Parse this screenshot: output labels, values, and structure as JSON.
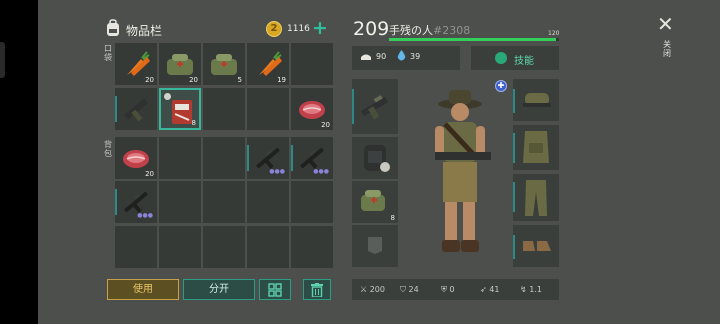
{
  "inventory": {
    "title": "物品栏",
    "coins": "1116",
    "pocket_label": "口袋",
    "backpack_label": "背包"
  },
  "slots": [
    {
      "icon": "carrot-icon",
      "count": "20"
    },
    {
      "icon": "medkit-bag-icon",
      "count": "20"
    },
    {
      "icon": "medkit-bag-icon",
      "count": "5"
    },
    {
      "icon": "carrot-icon",
      "count": "19"
    },
    {
      "icon": "",
      "count": ""
    },
    {
      "icon": "assault-rifle-icon",
      "count": ""
    },
    {
      "icon": "bandage-pack-icon",
      "count": "8"
    },
    {
      "icon": "",
      "count": ""
    },
    {
      "icon": "",
      "count": ""
    },
    {
      "icon": "raw-steak-icon",
      "count": "20"
    },
    {
      "icon": "raw-steak-icon",
      "count": "20"
    },
    {
      "icon": "",
      "count": ""
    },
    {
      "icon": "",
      "count": ""
    },
    {
      "icon": "black-rifle-icon",
      "count": ""
    },
    {
      "icon": "black-rifle-icon",
      "count": ""
    },
    {
      "icon": "black-rifle-icon",
      "count": ""
    },
    {
      "icon": "",
      "count": ""
    },
    {
      "icon": "",
      "count": ""
    },
    {
      "icon": "",
      "count": ""
    },
    {
      "icon": "",
      "count": ""
    },
    {
      "icon": "",
      "count": ""
    },
    {
      "icon": "",
      "count": ""
    },
    {
      "icon": "",
      "count": ""
    },
    {
      "icon": "",
      "count": ""
    },
    {
      "icon": "",
      "count": ""
    }
  ],
  "buttons": {
    "use": "使用",
    "split": "分开",
    "sort_icon": "grid-sort-icon",
    "delete_icon": "trash-icon"
  },
  "character": {
    "level": "209",
    "name": "手残の人",
    "id": "#2308",
    "xp_max": "120",
    "xp_fraction": 0.98,
    "food": "90",
    "water": "39",
    "skills_label": "技能",
    "weapon_slot_count": "8"
  },
  "combat_stats": {
    "attack": "200",
    "defense": "24",
    "armor": "0",
    "speed": "41",
    "crit": "1.1"
  },
  "close_label": "关闭",
  "colors": {
    "accent": "#2d9c82",
    "xp_green": "#32d05a",
    "use_gold": "#c6a04a"
  }
}
